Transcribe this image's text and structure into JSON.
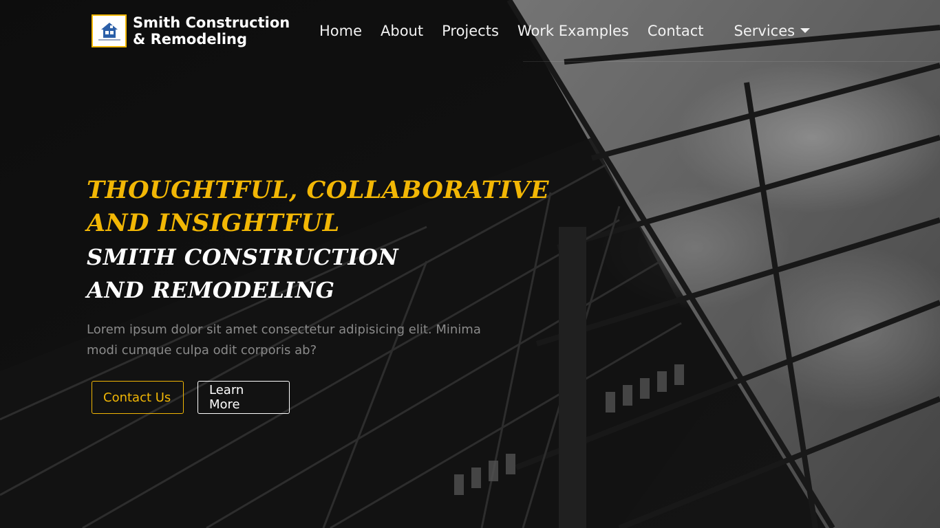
{
  "brand": {
    "name": "Smith Construction & Remodeling",
    "logo_icon": "house-logo-icon"
  },
  "nav": {
    "items": [
      {
        "label": "Home"
      },
      {
        "label": "About"
      },
      {
        "label": "Projects"
      },
      {
        "label": "Work Examples"
      },
      {
        "label": "Contact"
      }
    ],
    "services_label": "Services"
  },
  "hero": {
    "title": "THOUGHTFUL, COLLABORATIVE AND INSIGHTFUL",
    "subtitle_line1": "SMITH CONSTRUCTION",
    "subtitle_line2": "AND REMODELING",
    "text": "Lorem ipsum dolor sit amet consectetur adipisicing elit. Minima modi cumque culpa odit corporis ab?",
    "contact_button": "Contact Us",
    "learn_button": "Learn More"
  },
  "colors": {
    "accent": "#f2b705",
    "background": "#141414",
    "text_light": "#ffffff",
    "text_muted": "#8a8a8a"
  }
}
